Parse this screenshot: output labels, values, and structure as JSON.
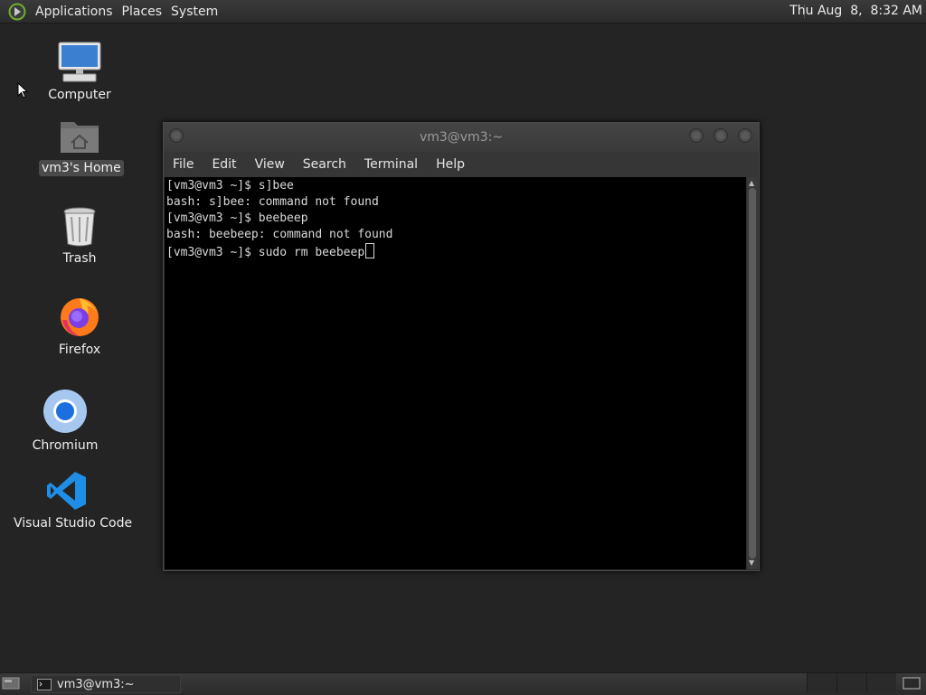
{
  "top_panel": {
    "menus": [
      "Applications",
      "Places",
      "System"
    ],
    "clock": "Thu Aug  8,  8:32 AM"
  },
  "desktop": {
    "icons": [
      {
        "label": "Computer",
        "icon": "computer-icon"
      },
      {
        "label": "vm3's Home",
        "icon": "home-folder-icon"
      },
      {
        "label": "Trash",
        "icon": "trash-icon"
      },
      {
        "label": "Firefox",
        "icon": "firefox-icon"
      },
      {
        "label": "Chromium",
        "icon": "chromium-icon"
      },
      {
        "label": "Visual Studio Code",
        "icon": "vscode-icon"
      }
    ]
  },
  "terminal": {
    "title": "vm3@vm3:~",
    "menu": [
      "File",
      "Edit",
      "View",
      "Search",
      "Terminal",
      "Help"
    ],
    "lines": [
      "[vm3@vm3 ~]$ s]bee",
      "bash: s]bee: command not found",
      "[vm3@vm3 ~]$ beebeep",
      "bash: beebeep: command not found",
      "[vm3@vm3 ~]$ sudo rm beebeep"
    ]
  },
  "taskbar": {
    "window_label": "vm3@vm3:~"
  },
  "colors": {
    "desktop_bg": "#242424",
    "panel_bg": "#2f2f2f",
    "terminal_bg": "#000000",
    "terminal_fg": "#d9d9d9"
  }
}
